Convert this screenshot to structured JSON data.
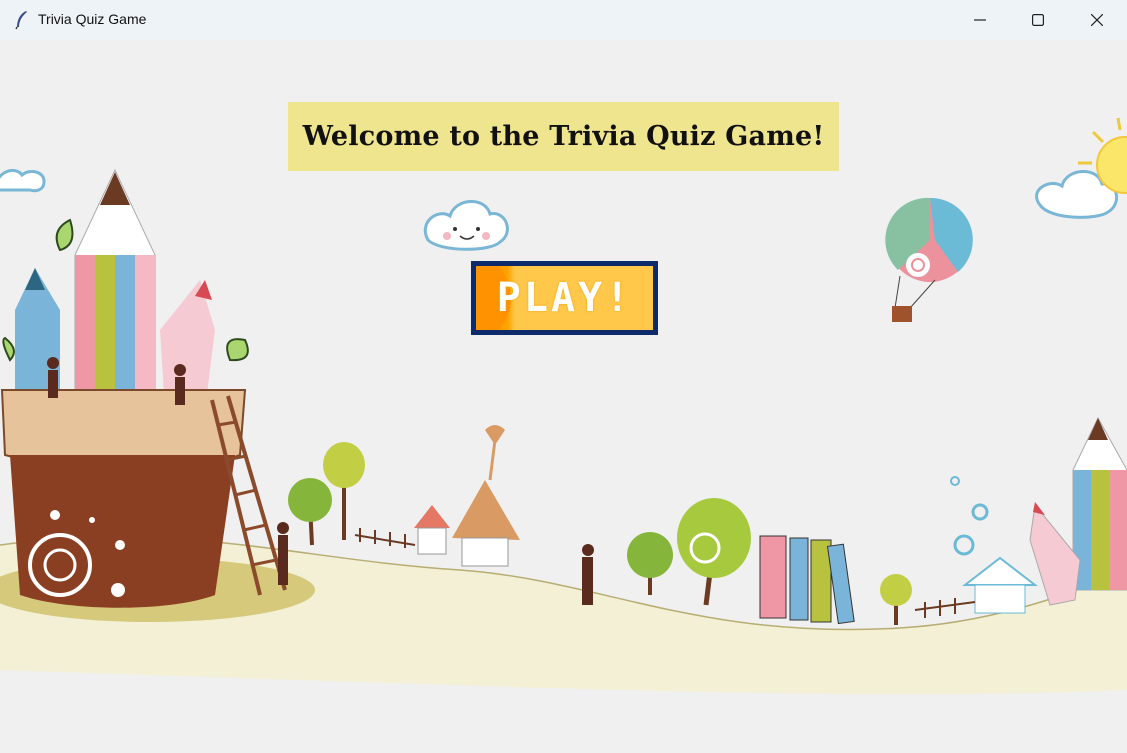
{
  "window": {
    "title": "Trivia Quiz Game",
    "controls": {
      "minimize": "—",
      "maximize": "☐",
      "close": "✕"
    }
  },
  "main": {
    "heading": "Welcome to the Trivia Quiz Game!",
    "play_button_label": "PLAY!"
  },
  "colors": {
    "heading_bg": "#efe58f",
    "play_border": "#0d2a6b",
    "play_fill": "#ffc84a"
  }
}
